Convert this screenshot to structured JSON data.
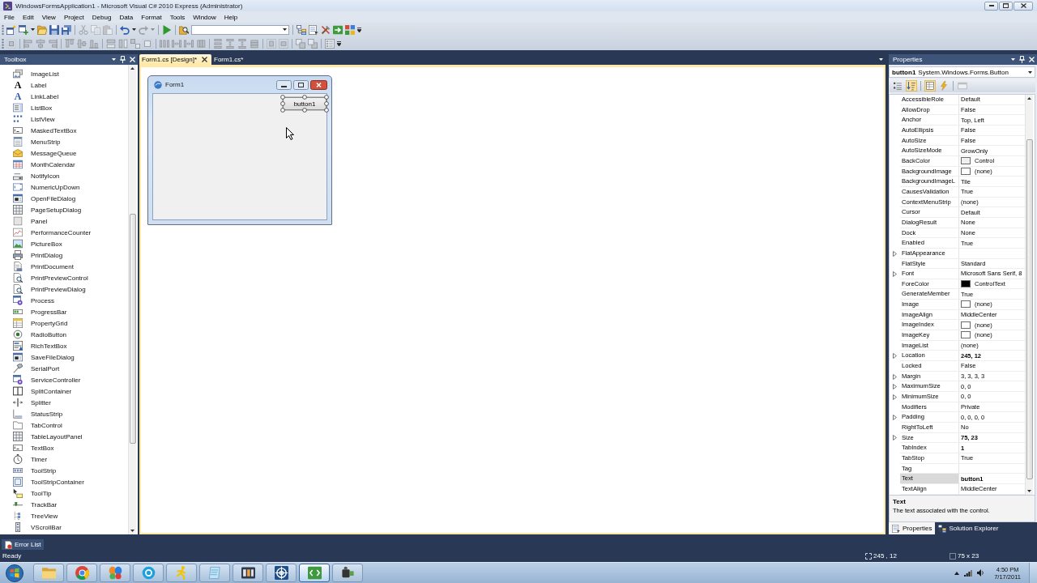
{
  "window": {
    "title": "WindowsFormsApplication1 - Microsoft Visual C# 2010 Express (Administrator)"
  },
  "menu": [
    "File",
    "Edit",
    "View",
    "Project",
    "Debug",
    "Data",
    "Format",
    "Tools",
    "Window",
    "Help"
  ],
  "toolbars": [
    {
      "items": [
        {
          "kind": "new-project",
          "disabled": false
        },
        {
          "kind": "add-item",
          "disabled": false
        },
        {
          "kind": "dropdown",
          "disabled": false
        },
        {
          "kind": "open",
          "disabled": false
        },
        {
          "kind": "save",
          "disabled": false
        },
        {
          "kind": "save-all",
          "disabled": false
        },
        {
          "kind": "separator"
        },
        {
          "kind": "cut",
          "disabled": true
        },
        {
          "kind": "copy",
          "disabled": true
        },
        {
          "kind": "paste",
          "disabled": true
        },
        {
          "kind": "separator"
        },
        {
          "kind": "undo",
          "disabled": false
        },
        {
          "kind": "dropdown",
          "disabled": false
        },
        {
          "kind": "redo",
          "disabled": true
        },
        {
          "kind": "dropdown",
          "disabled": true
        },
        {
          "kind": "separator"
        },
        {
          "kind": "start",
          "disabled": false
        },
        {
          "kind": "separator"
        },
        {
          "kind": "find",
          "disabled": false
        },
        {
          "kind": "combo",
          "disabled": false
        },
        {
          "kind": "separator"
        },
        {
          "kind": "solution",
          "disabled": false
        },
        {
          "kind": "properties",
          "disabled": false
        },
        {
          "kind": "toolbox",
          "disabled": false
        },
        {
          "kind": "browser",
          "disabled": false
        },
        {
          "kind": "extension",
          "disabled": false
        },
        {
          "kind": "overflow",
          "disabled": false
        }
      ]
    },
    {
      "items": [
        {
          "kind": "grid-snap",
          "disabled": true
        },
        {
          "kind": "separator"
        },
        {
          "kind": "align-left",
          "disabled": true
        },
        {
          "kind": "align-center",
          "disabled": true
        },
        {
          "kind": "align-right",
          "disabled": true
        },
        {
          "kind": "separator"
        },
        {
          "kind": "align-top",
          "disabled": true
        },
        {
          "kind": "align-middle",
          "disabled": true
        },
        {
          "kind": "align-bottom",
          "disabled": true
        },
        {
          "kind": "separator"
        },
        {
          "kind": "same-width",
          "disabled": true
        },
        {
          "kind": "same-height",
          "disabled": true
        },
        {
          "kind": "same-size",
          "disabled": true
        },
        {
          "kind": "size-grid",
          "disabled": true
        },
        {
          "kind": "separator"
        },
        {
          "kind": "hspace-equal",
          "disabled": true
        },
        {
          "kind": "hspace-increase",
          "disabled": true
        },
        {
          "kind": "hspace-decrease",
          "disabled": true
        },
        {
          "kind": "hspace-remove",
          "disabled": true
        },
        {
          "kind": "separator"
        },
        {
          "kind": "vspace-equal",
          "disabled": true
        },
        {
          "kind": "vspace-increase",
          "disabled": true
        },
        {
          "kind": "vspace-decrease",
          "disabled": true
        },
        {
          "kind": "vspace-remove",
          "disabled": true
        },
        {
          "kind": "separator"
        },
        {
          "kind": "center-h",
          "disabled": true
        },
        {
          "kind": "center-v",
          "disabled": true
        },
        {
          "kind": "separator"
        },
        {
          "kind": "bring-front",
          "disabled": true
        },
        {
          "kind": "send-back",
          "disabled": true
        },
        {
          "kind": "separator"
        },
        {
          "kind": "tab-order",
          "disabled": true
        },
        {
          "kind": "overflow",
          "disabled": false
        }
      ]
    }
  ],
  "toolbox": {
    "title": "Toolbox",
    "items": [
      {
        "label": "ImageList",
        "kind": "stack"
      },
      {
        "label": "Label",
        "kind": "glyph",
        "glyph": "A"
      },
      {
        "label": "LinkLabel",
        "kind": "link-glyph",
        "glyph": "A"
      },
      {
        "label": "ListBox",
        "kind": "listbox"
      },
      {
        "label": "ListView",
        "kind": "dots"
      },
      {
        "label": "MaskedTextBox",
        "kind": "field"
      },
      {
        "label": "MenuStrip",
        "kind": "menu"
      },
      {
        "label": "MessageQueue",
        "kind": "envelope"
      },
      {
        "label": "MonthCalendar",
        "kind": "calendar"
      },
      {
        "label": "NotifyIcon",
        "kind": "tray"
      },
      {
        "label": "NumericUpDown",
        "kind": "spinner"
      },
      {
        "label": "OpenFileDialog",
        "kind": "dialog"
      },
      {
        "label": "PageSetupDialog",
        "kind": "table"
      },
      {
        "label": "Panel",
        "kind": "panel"
      },
      {
        "label": "PerformanceCounter",
        "kind": "chart"
      },
      {
        "label": "PictureBox",
        "kind": "picture"
      },
      {
        "label": "PrintDialog",
        "kind": "printer"
      },
      {
        "label": "PrintDocument",
        "kind": "document"
      },
      {
        "label": "PrintPreviewControl",
        "kind": "preview"
      },
      {
        "label": "PrintPreviewDialog",
        "kind": "preview"
      },
      {
        "label": "Process",
        "kind": "gear"
      },
      {
        "label": "ProgressBar",
        "kind": "progress"
      },
      {
        "label": "PropertyGrid",
        "kind": "grid"
      },
      {
        "label": "RadioButton",
        "kind": "radio"
      },
      {
        "label": "RichTextBox",
        "kind": "richtext"
      },
      {
        "label": "SaveFileDialog",
        "kind": "dialog"
      },
      {
        "label": "SerialPort",
        "kind": "plug"
      },
      {
        "label": "ServiceController",
        "kind": "gear"
      },
      {
        "label": "SplitContainer",
        "kind": "split"
      },
      {
        "label": "Splitter",
        "kind": "splitter"
      },
      {
        "label": "StatusStrip",
        "kind": "status"
      },
      {
        "label": "TabControl",
        "kind": "tabs"
      },
      {
        "label": "TableLayoutPanel",
        "kind": "table"
      },
      {
        "label": "TextBox",
        "kind": "field"
      },
      {
        "label": "Timer",
        "kind": "clock"
      },
      {
        "label": "ToolStrip",
        "kind": "toolstrip"
      },
      {
        "label": "ToolStripContainer",
        "kind": "container"
      },
      {
        "label": "ToolTip",
        "kind": "tooltip"
      },
      {
        "label": "TrackBar",
        "kind": "slider"
      },
      {
        "label": "TreeView",
        "kind": "tree"
      },
      {
        "label": "VScrollBar",
        "kind": "scrollbar"
      }
    ]
  },
  "documents": {
    "tabs": [
      {
        "label": "Form1.cs [Design]*",
        "selected": true
      },
      {
        "label": "Form1.cs*",
        "selected": false
      }
    ],
    "form": {
      "title": "Form1",
      "button": {
        "text": "button1",
        "selected": true
      }
    }
  },
  "properties": {
    "title": "Properties",
    "object": {
      "name": "button1",
      "type": "System.Windows.Forms.Button"
    },
    "tools": [
      {
        "kind": "categorized",
        "selected": false,
        "disabled": false
      },
      {
        "kind": "alphabetical",
        "selected": true,
        "disabled": false
      },
      {
        "kind": "separator"
      },
      {
        "kind": "properties",
        "selected": true,
        "disabled": false
      },
      {
        "kind": "events",
        "selected": false,
        "disabled": false
      },
      {
        "kind": "separator"
      },
      {
        "kind": "pages",
        "selected": false,
        "disabled": true
      }
    ],
    "rows": [
      {
        "name": "AccessibleRole",
        "value": "Default",
        "modified": false,
        "selected": false
      },
      {
        "name": "AllowDrop",
        "value": "False",
        "modified": false,
        "selected": false
      },
      {
        "name": "Anchor",
        "value": "Top, Left",
        "modified": false,
        "selected": false
      },
      {
        "name": "AutoEllipsis",
        "value": "False",
        "modified": false,
        "selected": false
      },
      {
        "name": "AutoSize",
        "value": "False",
        "modified": false,
        "selected": false
      },
      {
        "name": "AutoSizeMode",
        "value": "GrowOnly",
        "modified": false,
        "selected": false
      },
      {
        "name": "BackColor",
        "value": "Control",
        "color": "#f0f0f0",
        "modified": false,
        "selected": false
      },
      {
        "name": "BackgroundImage",
        "value": "(none)",
        "preview": true,
        "modified": false,
        "selected": false
      },
      {
        "name": "BackgroundImageL",
        "value": "Tile",
        "modified": false,
        "selected": false
      },
      {
        "name": "CausesValidation",
        "value": "True",
        "modified": false,
        "selected": false
      },
      {
        "name": "ContextMenuStrip",
        "value": "(none)",
        "modified": false,
        "selected": false
      },
      {
        "name": "Cursor",
        "value": "Default",
        "modified": false,
        "selected": false
      },
      {
        "name": "DialogResult",
        "value": "None",
        "modified": false,
        "selected": false
      },
      {
        "name": "Dock",
        "value": "None",
        "modified": false,
        "selected": false
      },
      {
        "name": "Enabled",
        "value": "True",
        "modified": false,
        "selected": false
      },
      {
        "name": "FlatAppearance",
        "expanded": false,
        "selected": false
      },
      {
        "name": "FlatStyle",
        "value": "Standard",
        "modified": false,
        "selected": false
      },
      {
        "name": "Font",
        "value": "Microsoft Sans Serif, 8",
        "expanded": false,
        "modified": false,
        "selected": false
      },
      {
        "name": "ForeColor",
        "value": "ControlText",
        "color": "#000000",
        "modified": false,
        "selected": false
      },
      {
        "name": "GenerateMember",
        "value": "True",
        "modified": false,
        "selected": false
      },
      {
        "name": "Image",
        "value": "(none)",
        "preview": true,
        "modified": false,
        "selected": false
      },
      {
        "name": "ImageAlign",
        "value": "MiddleCenter",
        "modified": false,
        "selected": false
      },
      {
        "name": "ImageIndex",
        "value": "(none)",
        "preview": true,
        "modified": false,
        "selected": false
      },
      {
        "name": "ImageKey",
        "value": "(none)",
        "preview": true,
        "modified": false,
        "selected": false
      },
      {
        "name": "ImageList",
        "value": "(none)",
        "modified": false,
        "selected": false
      },
      {
        "name": "Location",
        "value": "245, 12",
        "expanded": false,
        "modified": true,
        "selected": false
      },
      {
        "name": "Locked",
        "value": "False",
        "modified": false,
        "selected": false
      },
      {
        "name": "Margin",
        "value": "3, 3, 3, 3",
        "expanded": false,
        "modified": false,
        "selected": false
      },
      {
        "name": "MaximumSize",
        "value": "0, 0",
        "expanded": false,
        "modified": false,
        "selected": false
      },
      {
        "name": "MinimumSize",
        "value": "0, 0",
        "expanded": false,
        "modified": false,
        "selected": false
      },
      {
        "name": "Modifiers",
        "value": "Private",
        "modified": false,
        "selected": false
      },
      {
        "name": "Padding",
        "value": "0, 0, 0, 0",
        "expanded": false,
        "modified": false,
        "selected": false
      },
      {
        "name": "RightToLeft",
        "value": "No",
        "modified": false,
        "selected": false
      },
      {
        "name": "Size",
        "value": "75, 23",
        "expanded": false,
        "modified": true,
        "selected": false
      },
      {
        "name": "TabIndex",
        "value": "1",
        "modified": true,
        "selected": false
      },
      {
        "name": "TabStop",
        "value": "True",
        "modified": false,
        "selected": false
      },
      {
        "name": "Tag",
        "selected": false
      },
      {
        "name": "Text",
        "value": "button1",
        "modified": true,
        "selected": true
      },
      {
        "name": "TextAlign",
        "value": "MiddleCenter",
        "modified": false,
        "selected": false
      }
    ],
    "description": {
      "title": "Text",
      "text": "The text associated with the control."
    },
    "tabs": [
      {
        "label": "Properties",
        "kind": "properties",
        "selected": true
      },
      {
        "label": "Solution Explorer",
        "kind": "solution",
        "selected": false
      }
    ]
  },
  "error_list": {
    "label": "Error List"
  },
  "status_bar": {
    "text": "Ready",
    "position": "245 , 12",
    "size": "75 x 23"
  },
  "taskbar": {
    "apps": [
      {
        "kind": "folder",
        "selected": false
      },
      {
        "kind": "wheel",
        "selected": false
      },
      {
        "kind": "butterfly",
        "selected": false
      },
      {
        "kind": "bubble",
        "selected": false
      },
      {
        "kind": "runner",
        "selected": false
      },
      {
        "kind": "notepad",
        "selected": false
      },
      {
        "kind": "hex",
        "selected": false
      },
      {
        "kind": "crosshair",
        "selected": false
      },
      {
        "kind": "code",
        "selected": true
      },
      {
        "kind": "camcorder",
        "selected": false
      }
    ],
    "time": "4:50 PM",
    "date": "7/17/2011"
  }
}
